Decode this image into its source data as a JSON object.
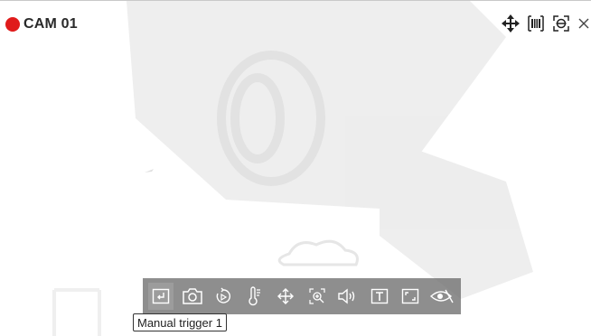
{
  "camera": {
    "name": "CAM 01",
    "recording_color": "#e01b1b"
  },
  "top_controls": [
    {
      "name": "move-icon"
    },
    {
      "name": "film-icon"
    },
    {
      "name": "smart-focus-icon"
    },
    {
      "name": "close-icon"
    }
  ],
  "toolbar": {
    "background": "#6e6e6e",
    "items": [
      {
        "name": "manual-trigger-icon",
        "active": true
      },
      {
        "name": "camera-icon",
        "active": false
      },
      {
        "name": "playback-icon",
        "active": false
      },
      {
        "name": "thermometer-icon",
        "active": false
      },
      {
        "name": "ptz-icon",
        "active": false
      },
      {
        "name": "zoom-icon",
        "active": false
      },
      {
        "name": "audio-icon",
        "active": false
      },
      {
        "name": "text-icon",
        "active": false
      },
      {
        "name": "fullscreen-icon",
        "active": false
      },
      {
        "name": "privacy-eye-icon",
        "active": false
      }
    ]
  },
  "tooltip": {
    "text": "Manual trigger 1"
  }
}
